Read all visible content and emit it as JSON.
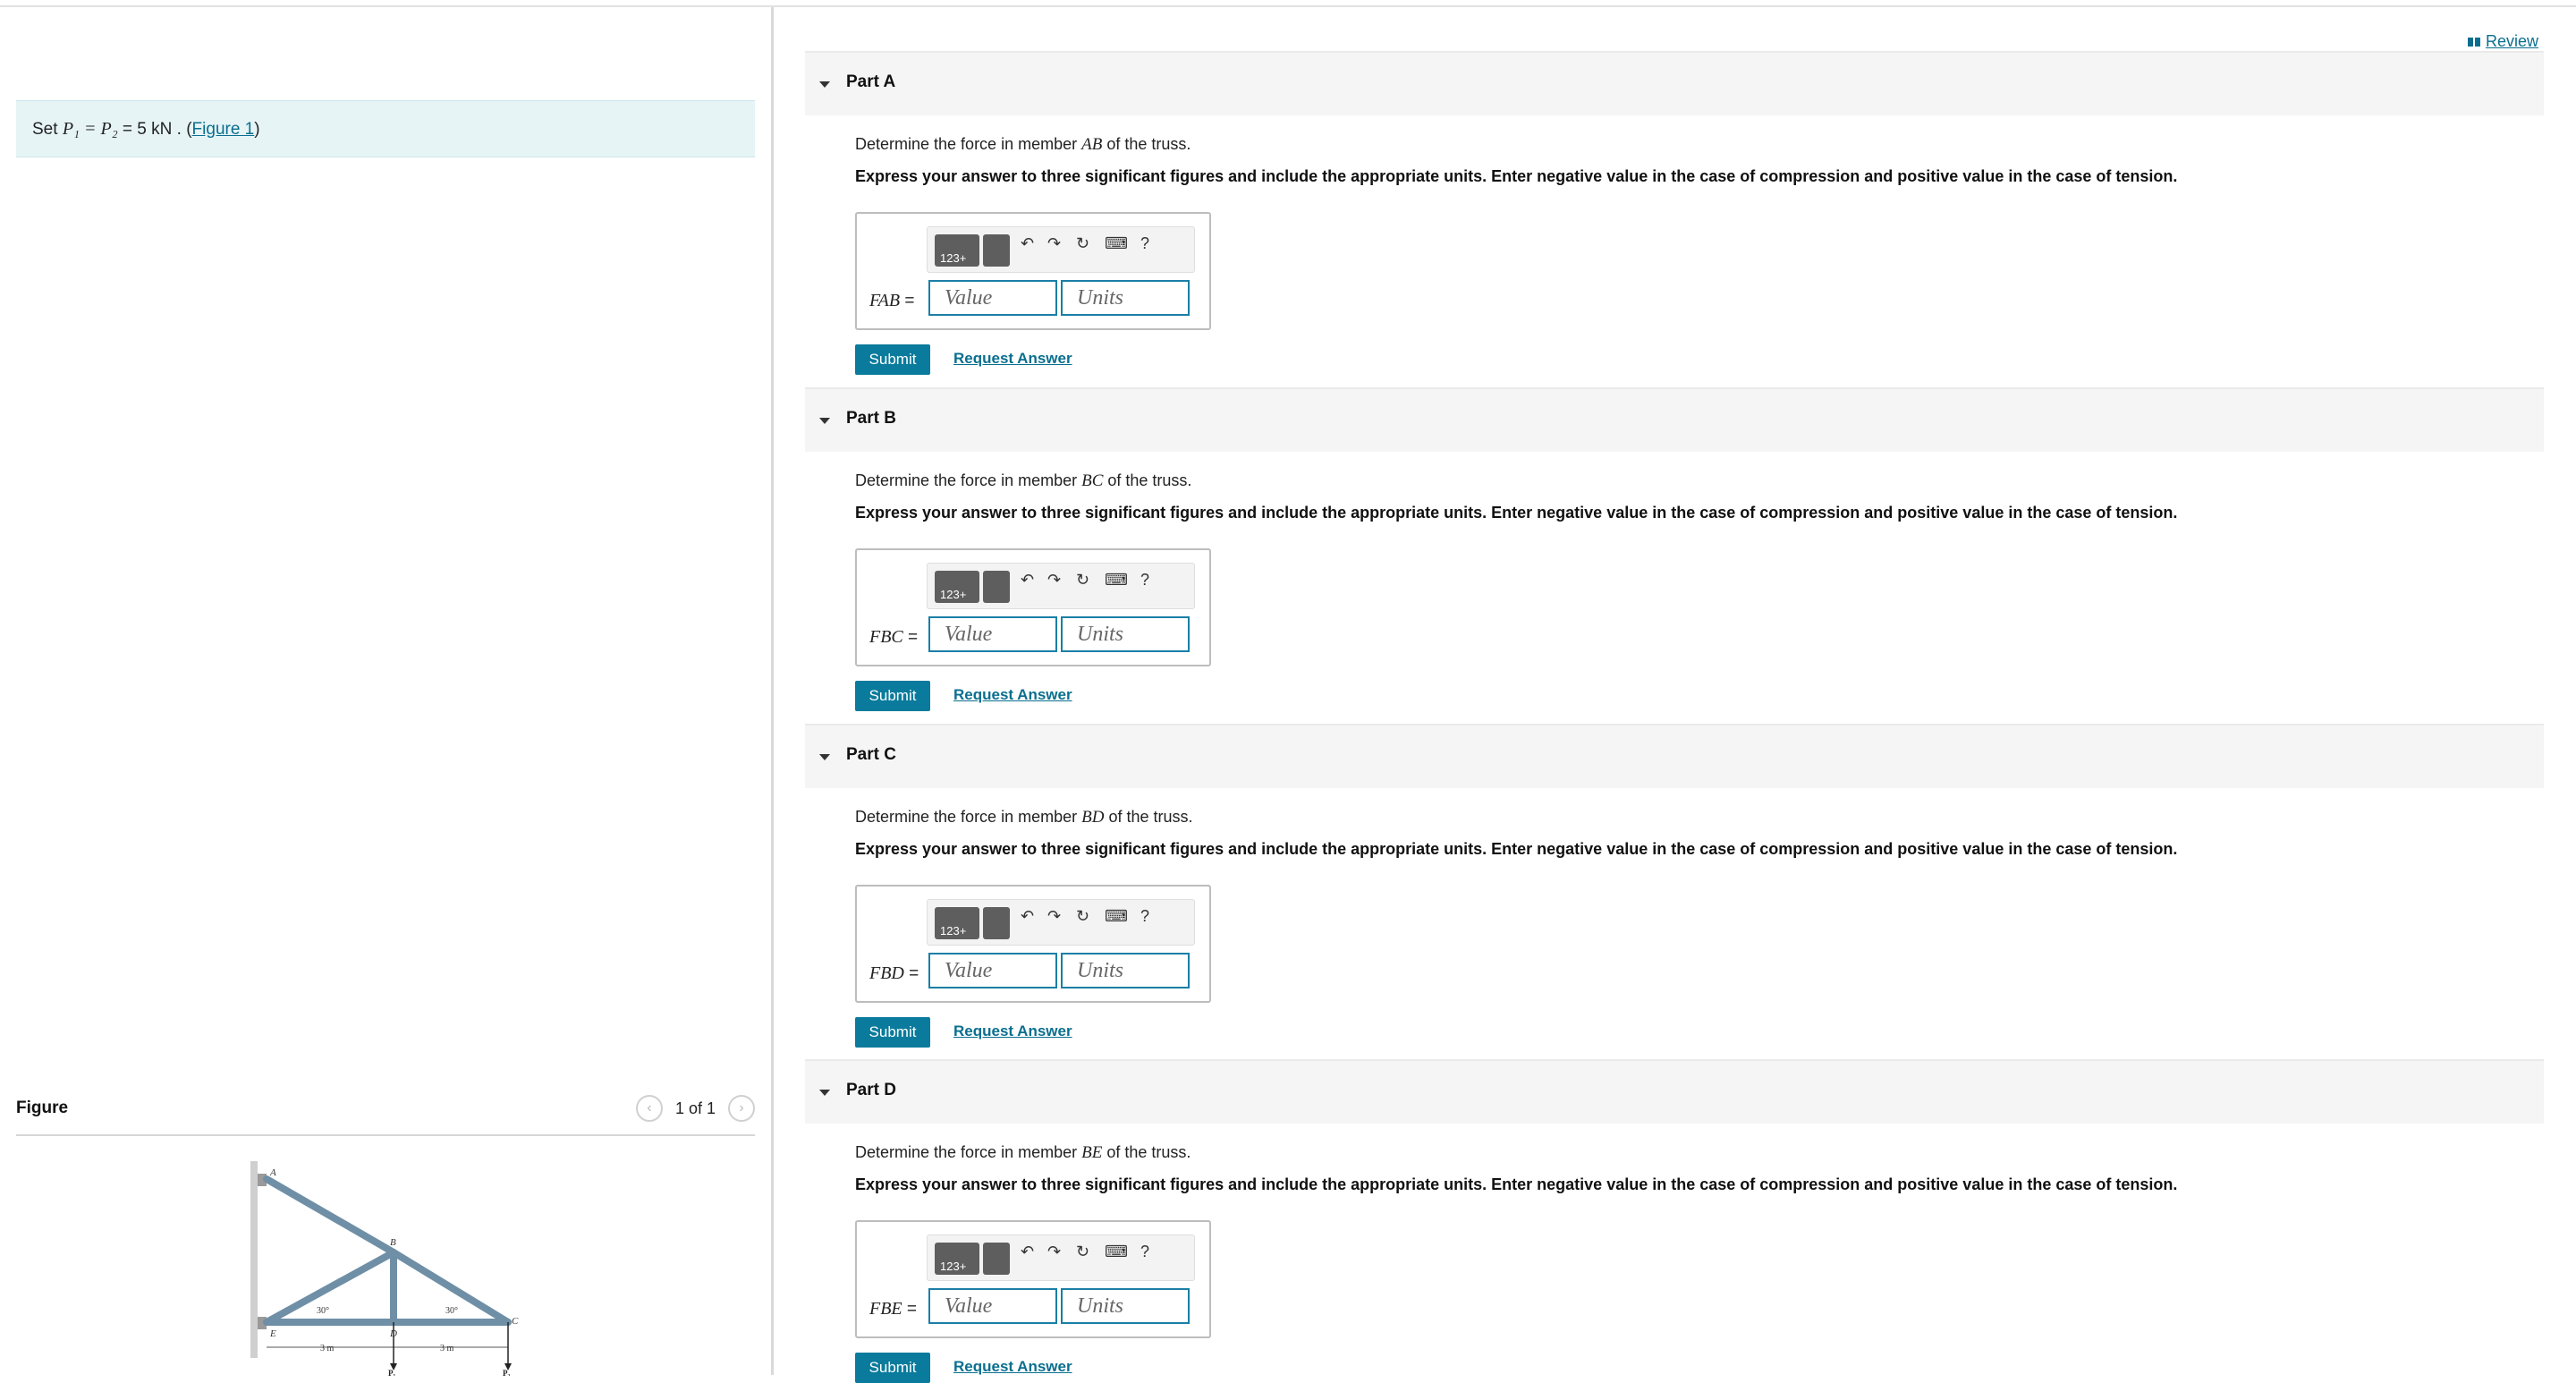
{
  "left": {
    "intro_prefix": "Set ",
    "intro_math": "P₁ = P₂",
    "intro_value": " = 5 kN . (",
    "figure_link": "Figure 1",
    "intro_suffix": ")",
    "figure_title": "Figure",
    "pager_text": "1 of 1",
    "truss_labels": {
      "A": "A",
      "B": "B",
      "C": "C",
      "D": "D",
      "E": "E",
      "angle1": "30°",
      "angle2": "30°",
      "dim1": "3 m",
      "dim2": "3 m",
      "p1": "P₁",
      "p2": "P₂"
    }
  },
  "review": {
    "label": "Review"
  },
  "parts": [
    {
      "title": "Part A",
      "q_prefix": "Determine the force in member ",
      "member": "AB",
      "q_suffix": " of the truss.",
      "instruction": "Express your answer to three significant figures and include the appropriate units. Enter negative value in the case of compression and positive value in the case of tension.",
      "var_prefix": "F",
      "var_sub": "AB",
      "eq": " =",
      "value_placeholder": "Value",
      "units_placeholder": "Units",
      "toolbar_label": "123+",
      "submit": "Submit",
      "request": "Request Answer"
    },
    {
      "title": "Part B",
      "q_prefix": "Determine the force in member ",
      "member": "BC",
      "q_suffix": " of the truss.",
      "instruction": "Express your answer to three significant figures and include the appropriate units. Enter negative value in the case of compression and positive value in the case of tension.",
      "var_prefix": "F",
      "var_sub": "BC",
      "eq": " =",
      "value_placeholder": "Value",
      "units_placeholder": "Units",
      "toolbar_label": "123+",
      "submit": "Submit",
      "request": "Request Answer"
    },
    {
      "title": "Part C",
      "q_prefix": "Determine the force in member ",
      "member": "BD",
      "q_suffix": " of the truss.",
      "instruction": "Express your answer to three significant figures and include the appropriate units. Enter negative value in the case of compression and positive value in the case of tension.",
      "var_prefix": "F",
      "var_sub": "BD",
      "eq": " =",
      "value_placeholder": "Value",
      "units_placeholder": "Units",
      "toolbar_label": "123+",
      "submit": "Submit",
      "request": "Request Answer"
    },
    {
      "title": "Part D",
      "q_prefix": "Determine the force in member ",
      "member": "BE",
      "q_suffix": " of the truss.",
      "instruction": "Express your answer to three significant figures and include the appropriate units. Enter negative value in the case of compression and positive value in the case of tension.",
      "var_prefix": "F",
      "var_sub": "BE",
      "eq": " =",
      "value_placeholder": "Value",
      "units_placeholder": "Units",
      "toolbar_label": "123+",
      "submit": "Submit",
      "request": "Request Answer"
    }
  ],
  "toolbar_icons": [
    "undo-icon",
    "redo-icon",
    "reset-icon",
    "keyboard-icon",
    "help-icon"
  ],
  "colors": {
    "accent": "#0a7b9c",
    "link": "#0a6f8f",
    "intro_bg": "#e6f4f6",
    "truss": "#6f8fa6"
  }
}
